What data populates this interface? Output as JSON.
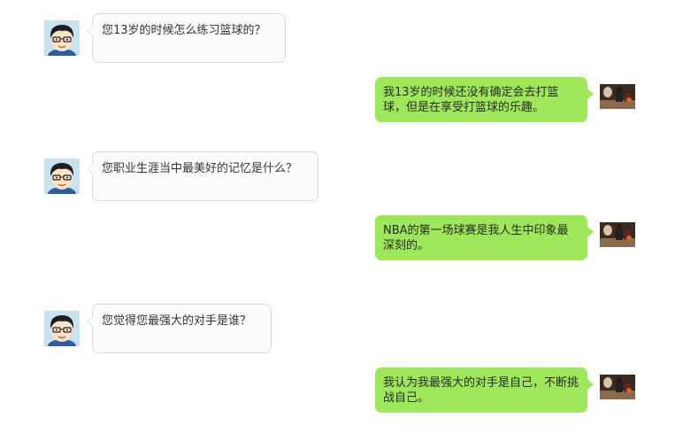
{
  "messages": [
    {
      "side": "in",
      "text": "您13岁的时候怎么练习篮球的？"
    },
    {
      "side": "out",
      "text": "我13岁的时候还没有确定会去打篮球，但是在享受打篮球的乐趣。"
    },
    {
      "side": "in",
      "text": "您职业生涯当中最美好的记忆是什么？"
    },
    {
      "side": "out",
      "text": "NBA的第一场球赛是我人生中印象最深刻的。"
    },
    {
      "side": "in",
      "text": "您觉得您最强大的对手是谁？"
    },
    {
      "side": "out",
      "text": "我认为我最强大的对手是自己，不断挑战自己。"
    }
  ],
  "colors": {
    "incoming_bubble": "#fcfcfc",
    "incoming_border": "#dcdcdc",
    "outgoing_bubble": "#9ee65a"
  },
  "icons": {
    "interviewer_avatar": "cartoon-boy-with-glasses-avatar",
    "player_avatar": "basketball-player-photo-avatar"
  }
}
